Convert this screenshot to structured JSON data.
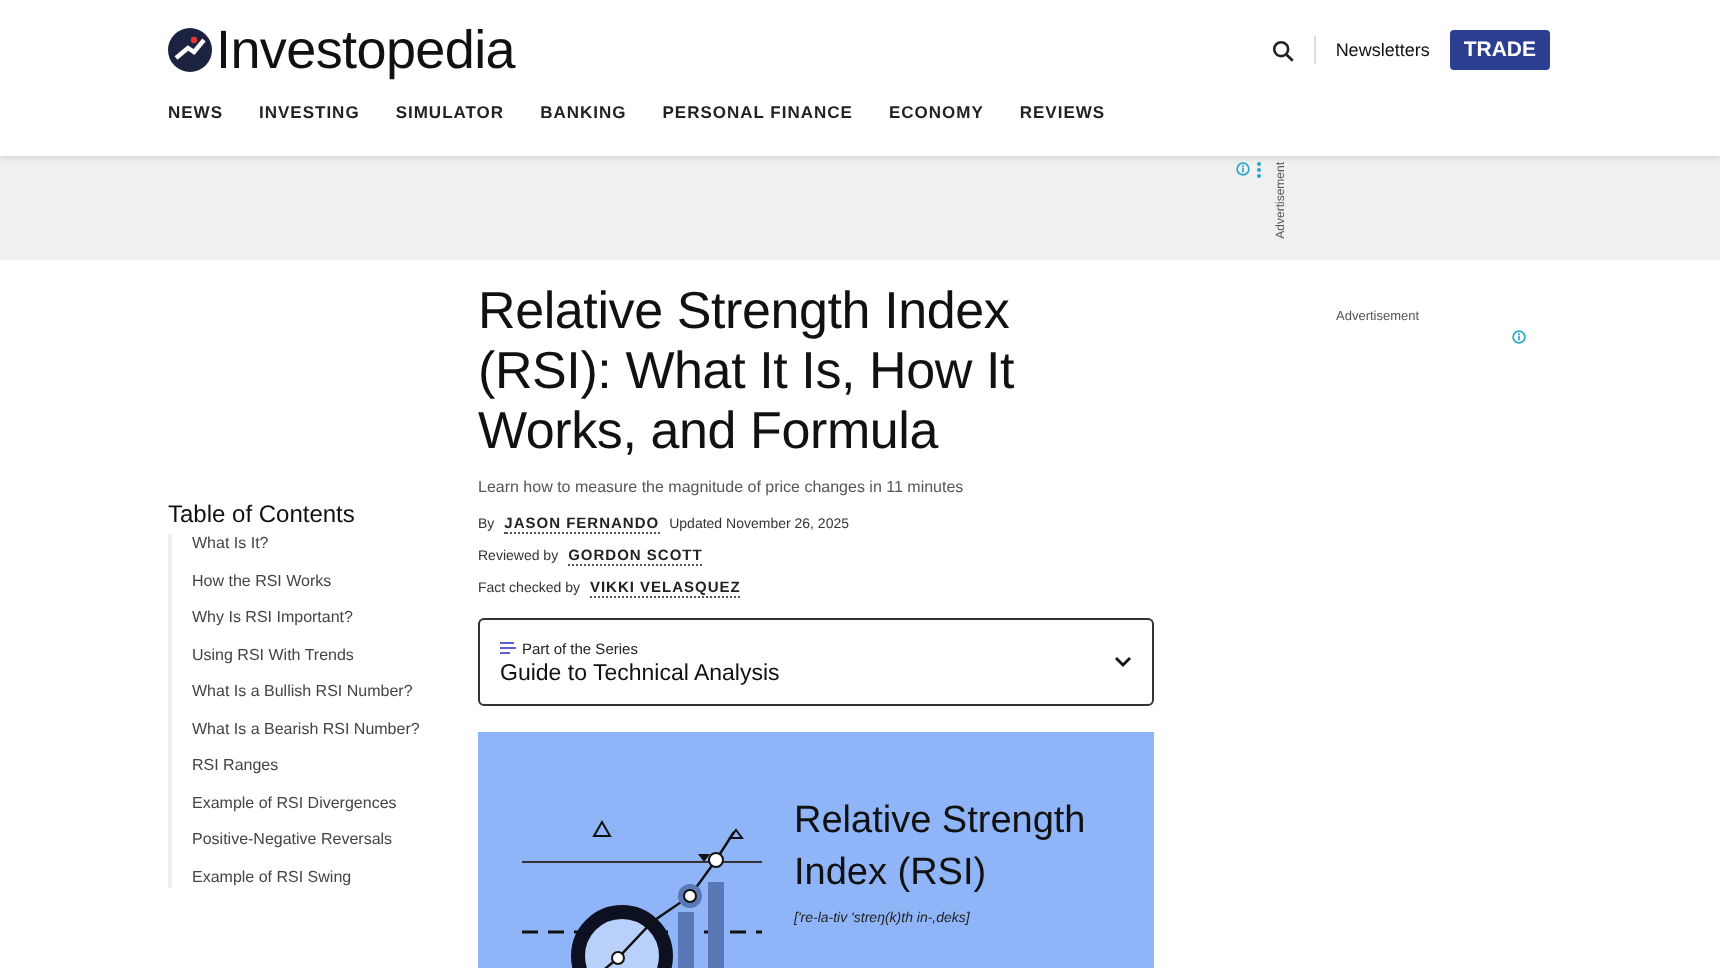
{
  "brand": {
    "name": "Investopedia"
  },
  "nav": [
    "NEWS",
    "INVESTING",
    "SIMULATOR",
    "BANKING",
    "PERSONAL FINANCE",
    "ECONOMY",
    "REVIEWS"
  ],
  "header_actions": {
    "newsletters": "Newsletters",
    "trade": "TRADE"
  },
  "ad_band": {
    "label": "Advertisement"
  },
  "toc": {
    "title": "Table of Contents",
    "items": [
      "What Is It?",
      "How the RSI Works",
      "Why Is RSI Important?",
      "Using RSI With Trends",
      "What Is a Bullish RSI Number?",
      "What Is a Bearish RSI Number?",
      "RSI Ranges",
      "Example of RSI Divergences",
      "Positive-Negative Reversals",
      "Example of RSI Swing"
    ]
  },
  "article": {
    "title": "Relative Strength Index (RSI): What It Is, How It Works, and Formula",
    "subtitle": "Learn how to measure the magnitude of price changes in 11 minutes",
    "credits": [
      {
        "prefix": "By",
        "name": "JASON FERNANDO",
        "suffix": "Updated November 26, 2025"
      },
      {
        "prefix": "Reviewed by",
        "name": "GORDON SCOTT"
      },
      {
        "prefix": "Fact checked by",
        "name": "VIKKI VELASQUEZ"
      }
    ],
    "series": {
      "label": "Part of the Series",
      "title": "Guide to Technical Analysis",
      "expanded": false
    },
    "figure": {
      "heading": "Relative Strength Index (RSI)",
      "pronunciation": "['re-la-tiv 'streŋ(k)th in-,deks]"
    }
  },
  "side_ad": {
    "label": "Advertisement"
  }
}
